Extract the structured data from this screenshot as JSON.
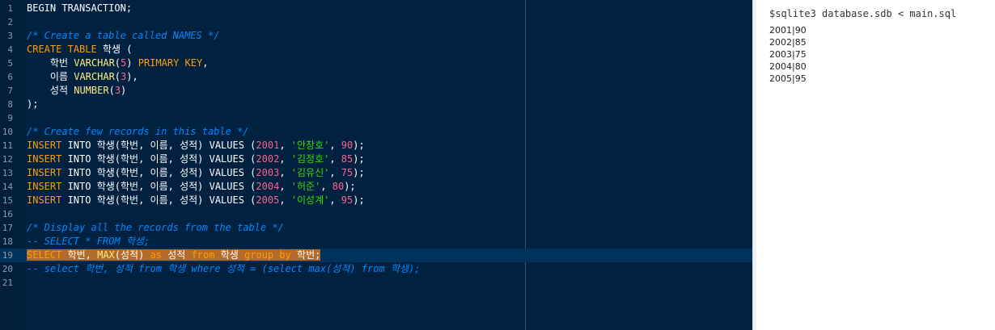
{
  "editor": {
    "lines": [
      {
        "no": "1",
        "tokens": [
          {
            "text": "BEGIN TRANSACTION;",
            "color": "#ffffff"
          }
        ]
      },
      {
        "no": "2",
        "tokens": []
      },
      {
        "no": "3",
        "tokens": [
          {
            "text": "/* Create a table called NAMES */",
            "color": "#0088ff",
            "italic": true
          }
        ]
      },
      {
        "no": "4",
        "tokens": [
          {
            "text": "CREATE TABLE ",
            "color": "#ff9d00"
          },
          {
            "text": "학생 (",
            "color": "#ffffff"
          }
        ]
      },
      {
        "no": "5",
        "tokens": [
          {
            "text": "    학번 ",
            "color": "#ffffff"
          },
          {
            "text": "VARCHAR",
            "color": "#ffee80"
          },
          {
            "text": "(",
            "color": "#ffffff"
          },
          {
            "text": "5",
            "color": "#ff628c"
          },
          {
            "text": ") ",
            "color": "#ffffff"
          },
          {
            "text": "PRIMARY KEY",
            "color": "#ff9d00"
          },
          {
            "text": ",",
            "color": "#ffffff"
          }
        ]
      },
      {
        "no": "6",
        "tokens": [
          {
            "text": "    이름 ",
            "color": "#ffffff"
          },
          {
            "text": "VARCHAR",
            "color": "#ffee80"
          },
          {
            "text": "(",
            "color": "#ffffff"
          },
          {
            "text": "3",
            "color": "#ff628c"
          },
          {
            "text": "),",
            "color": "#ffffff"
          }
        ]
      },
      {
        "no": "7",
        "tokens": [
          {
            "text": "    성적 ",
            "color": "#ffffff"
          },
          {
            "text": "NUMBER",
            "color": "#ffee80"
          },
          {
            "text": "(",
            "color": "#ffffff"
          },
          {
            "text": "3",
            "color": "#ff628c"
          },
          {
            "text": ")",
            "color": "#ffffff"
          }
        ]
      },
      {
        "no": "8",
        "tokens": [
          {
            "text": ");",
            "color": "#ffffff"
          }
        ]
      },
      {
        "no": "9",
        "tokens": []
      },
      {
        "no": "10",
        "tokens": [
          {
            "text": "/* Create few records in this table */",
            "color": "#0088ff",
            "italic": true
          }
        ]
      },
      {
        "no": "11",
        "tokens": [
          {
            "text": "INSERT ",
            "color": "#ff9d00"
          },
          {
            "text": "INTO 학생(학번, 이름, 성적) VALUES (",
            "color": "#ffffff"
          },
          {
            "text": "2001",
            "color": "#ff628c"
          },
          {
            "text": ", ",
            "color": "#ffffff"
          },
          {
            "text": "'안창호'",
            "color": "#3ad900"
          },
          {
            "text": ", ",
            "color": "#ffffff"
          },
          {
            "text": "90",
            "color": "#ff628c"
          },
          {
            "text": ");",
            "color": "#ffffff"
          }
        ]
      },
      {
        "no": "12",
        "tokens": [
          {
            "text": "INSERT ",
            "color": "#ff9d00"
          },
          {
            "text": "INTO 학생(학번, 이름, 성적) VALUES (",
            "color": "#ffffff"
          },
          {
            "text": "2002",
            "color": "#ff628c"
          },
          {
            "text": ", ",
            "color": "#ffffff"
          },
          {
            "text": "'김정호'",
            "color": "#3ad900"
          },
          {
            "text": ", ",
            "color": "#ffffff"
          },
          {
            "text": "85",
            "color": "#ff628c"
          },
          {
            "text": ");",
            "color": "#ffffff"
          }
        ]
      },
      {
        "no": "13",
        "tokens": [
          {
            "text": "INSERT ",
            "color": "#ff9d00"
          },
          {
            "text": "INTO 학생(학번, 이름, 성적) VALUES (",
            "color": "#ffffff"
          },
          {
            "text": "2003",
            "color": "#ff628c"
          },
          {
            "text": ", ",
            "color": "#ffffff"
          },
          {
            "text": "'김유신'",
            "color": "#3ad900"
          },
          {
            "text": ", ",
            "color": "#ffffff"
          },
          {
            "text": "75",
            "color": "#ff628c"
          },
          {
            "text": ");",
            "color": "#ffffff"
          }
        ]
      },
      {
        "no": "14",
        "tokens": [
          {
            "text": "INSERT ",
            "color": "#ff9d00"
          },
          {
            "text": "INTO 학생(학번, 이름, 성적) VALUES (",
            "color": "#ffffff"
          },
          {
            "text": "2004",
            "color": "#ff628c"
          },
          {
            "text": ", ",
            "color": "#ffffff"
          },
          {
            "text": "'허준'",
            "color": "#3ad900"
          },
          {
            "text": ", ",
            "color": "#ffffff"
          },
          {
            "text": "80",
            "color": "#ff628c"
          },
          {
            "text": ");",
            "color": "#ffffff"
          }
        ]
      },
      {
        "no": "15",
        "tokens": [
          {
            "text": "INSERT ",
            "color": "#ff9d00"
          },
          {
            "text": "INTO 학생(학번, 이름, 성적) VALUES (",
            "color": "#ffffff"
          },
          {
            "text": "2005",
            "color": "#ff628c"
          },
          {
            "text": ", ",
            "color": "#ffffff"
          },
          {
            "text": "'이성계'",
            "color": "#3ad900"
          },
          {
            "text": ", ",
            "color": "#ffffff"
          },
          {
            "text": "95",
            "color": "#ff628c"
          },
          {
            "text": ");",
            "color": "#ffffff"
          }
        ]
      },
      {
        "no": "16",
        "tokens": []
      },
      {
        "no": "17",
        "tokens": [
          {
            "text": "/* Display all the records from the table */",
            "color": "#0088ff",
            "italic": true
          }
        ]
      },
      {
        "no": "18",
        "tokens": [
          {
            "text": "-- SELECT * FROM 학생;",
            "color": "#0088ff",
            "italic": true
          }
        ]
      },
      {
        "no": "19",
        "active": true,
        "tokens": [
          {
            "text": "",
            "caret": true
          },
          {
            "text": "SELECT ",
            "color": "#ff9d00",
            "hl": true
          },
          {
            "text": "학번, ",
            "color": "#ffffff",
            "hl": true
          },
          {
            "text": "MAX",
            "color": "#ffee80",
            "hl": true
          },
          {
            "text": "(성적) ",
            "color": "#ffffff",
            "hl": true
          },
          {
            "text": "as ",
            "color": "#ff9d00",
            "hl": true
          },
          {
            "text": "성적 ",
            "color": "#ffffff",
            "hl": true
          },
          {
            "text": "from ",
            "color": "#ff9d00",
            "hl": true
          },
          {
            "text": "학생 ",
            "color": "#ffffff",
            "hl": true
          },
          {
            "text": "group by ",
            "color": "#ff9d00",
            "hl": true
          },
          {
            "text": "학번;",
            "color": "#ffffff",
            "hl": true
          }
        ]
      },
      {
        "no": "20",
        "tokens": [
          {
            "text": "-- select 학번, 성적 from 학생 where 성적 = (select max(성적) from 학생);",
            "color": "#0088ff",
            "italic": true
          }
        ]
      },
      {
        "no": "21",
        "tokens": []
      }
    ]
  },
  "output": {
    "command": "$sqlite3 database.sdb < main.sql",
    "results": [
      "2001|90",
      "2002|85",
      "2003|75",
      "2004|80",
      "2005|95"
    ]
  }
}
